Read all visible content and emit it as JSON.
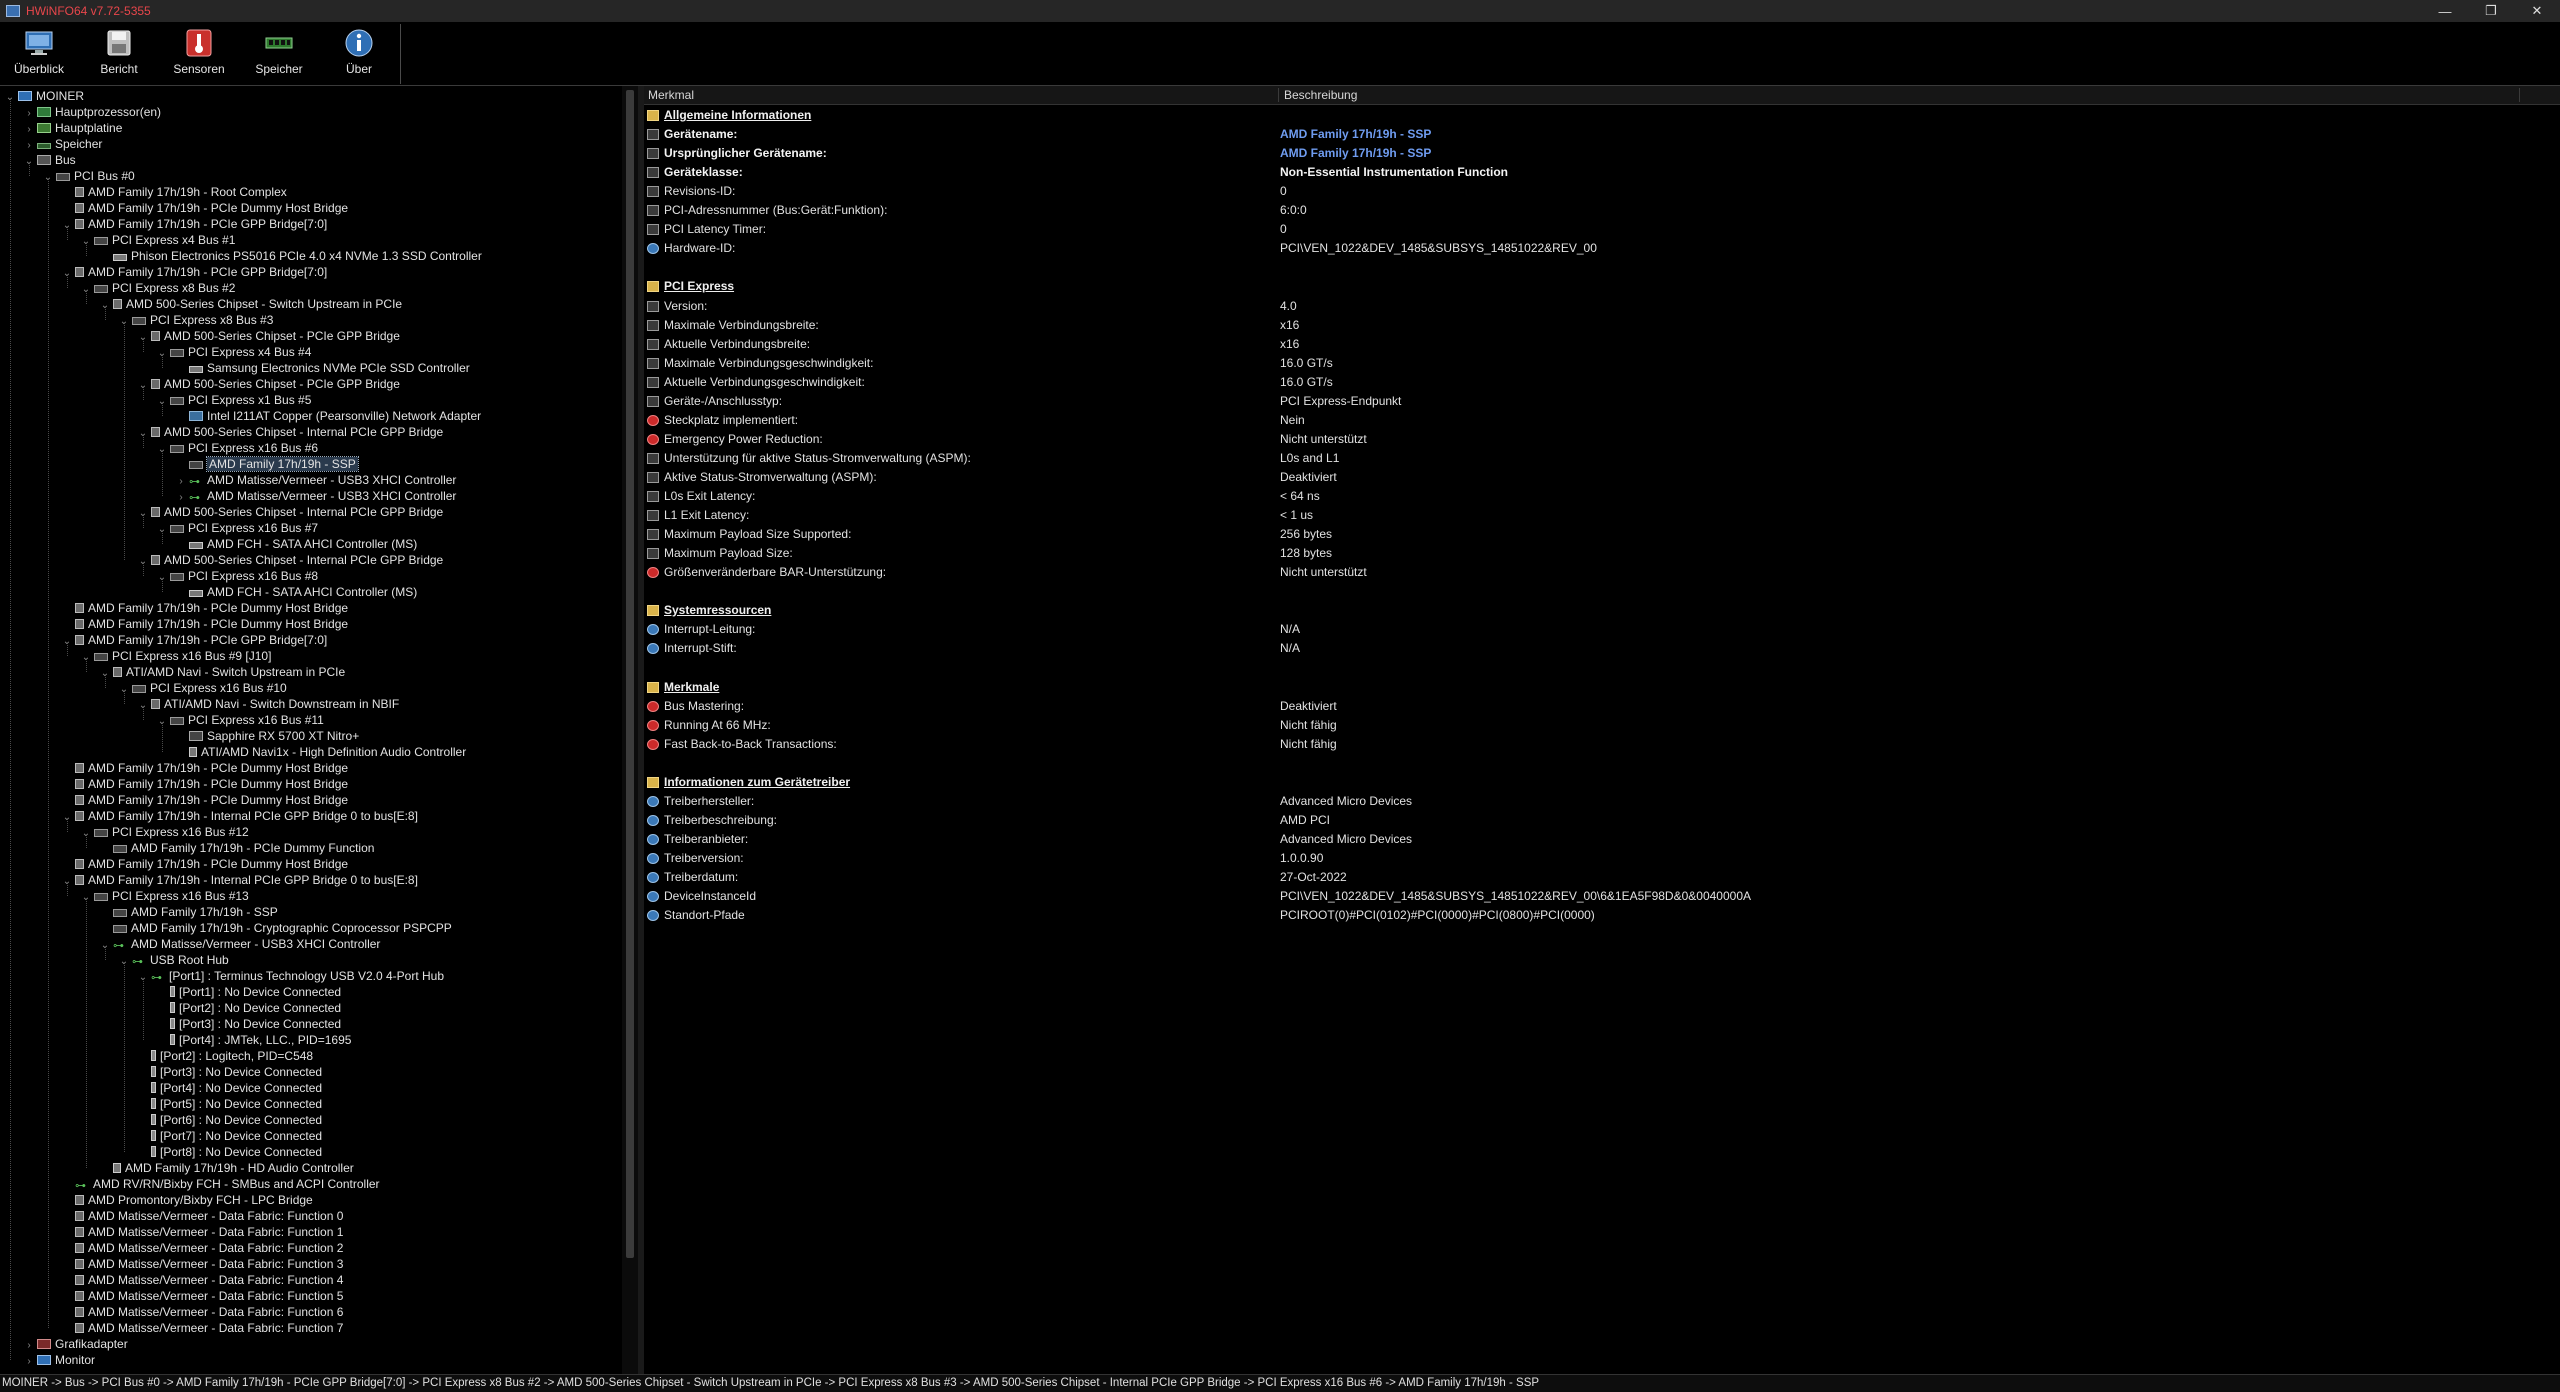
{
  "window": {
    "title": "HWiNFO64 v7.72-5355",
    "controls": {
      "minimize": "—",
      "maximize": "❐",
      "close": "✕"
    }
  },
  "toolbar": {
    "buttons": [
      {
        "label": "Überblick",
        "icon": "overview-icon"
      },
      {
        "label": "Bericht",
        "icon": "save-report-icon"
      },
      {
        "label": "Sensoren",
        "icon": "thermometer-icon"
      },
      {
        "label": "Speicher",
        "icon": "memory-module-icon"
      },
      {
        "label": "Über",
        "icon": "info-icon"
      }
    ]
  },
  "tree": [
    {
      "d": 0,
      "t": "MOINER",
      "i": "pc",
      "x": "open"
    },
    {
      "d": 1,
      "t": "Hauptprozessor(en)",
      "i": "cpu",
      "x": "closed"
    },
    {
      "d": 1,
      "t": "Hauptplatine",
      "i": "board",
      "x": "closed"
    },
    {
      "d": 1,
      "t": "Speicher",
      "i": "mem",
      "x": "closed"
    },
    {
      "d": 1,
      "t": "Bus",
      "i": "bus",
      "x": "open"
    },
    {
      "d": 2,
      "t": "PCI Bus #0",
      "i": "pci",
      "x": "open"
    },
    {
      "d": 3,
      "t": "AMD Family 17h/19h - Root Complex",
      "i": "chip"
    },
    {
      "d": 3,
      "t": "AMD Family 17h/19h - PCIe Dummy Host Bridge",
      "i": "chip"
    },
    {
      "d": 3,
      "t": "AMD Family 17h/19h - PCIe GPP Bridge[7:0]",
      "i": "chip",
      "x": "open"
    },
    {
      "d": 4,
      "t": "PCI Express x4 Bus #1",
      "i": "pci",
      "x": "open"
    },
    {
      "d": 5,
      "t": "Phison Electronics PS5016 PCIe 4.0 x4 NVMe 1.3 SSD Controller",
      "i": "disk"
    },
    {
      "d": 3,
      "t": "AMD Family 17h/19h - PCIe GPP Bridge[7:0]",
      "i": "chip",
      "x": "open"
    },
    {
      "d": 4,
      "t": "PCI Express x8 Bus #2",
      "i": "pci",
      "x": "open"
    },
    {
      "d": 5,
      "t": "AMD 500-Series Chipset - Switch Upstream in PCIe",
      "i": "chip",
      "x": "open"
    },
    {
      "d": 6,
      "t": "PCI Express x8 Bus #3",
      "i": "pci",
      "x": "open"
    },
    {
      "d": 7,
      "t": "AMD 500-Series Chipset - PCIe GPP Bridge",
      "i": "chip",
      "x": "open"
    },
    {
      "d": 8,
      "t": "PCI Express x4 Bus #4",
      "i": "pci",
      "x": "open"
    },
    {
      "d": 9,
      "t": "Samsung Electronics NVMe PCIe SSD Controller",
      "i": "disk"
    },
    {
      "d": 7,
      "t": "AMD 500-Series Chipset - PCIe GPP Bridge",
      "i": "chip",
      "x": "open"
    },
    {
      "d": 8,
      "t": "PCI Express x1 Bus #5",
      "i": "pci",
      "x": "open"
    },
    {
      "d": 9,
      "t": "Intel I211AT Copper (Pearsonville) Network Adapter",
      "i": "net"
    },
    {
      "d": 7,
      "t": "AMD 500-Series Chipset - Internal PCIe GPP Bridge",
      "i": "chip",
      "x": "open"
    },
    {
      "d": 8,
      "t": "PCI Express x16 Bus #6",
      "i": "pci",
      "x": "open"
    },
    {
      "d": 9,
      "t": "AMD Family 17h/19h - SSP",
      "i": "pci",
      "sel": true
    },
    {
      "d": 9,
      "t": "AMD Matisse/Vermeer - USB3 XHCI Controller",
      "i": "usb",
      "x": "closed"
    },
    {
      "d": 9,
      "t": "AMD Matisse/Vermeer - USB3 XHCI Controller",
      "i": "usb",
      "x": "closed"
    },
    {
      "d": 7,
      "t": "AMD 500-Series Chipset - Internal PCIe GPP Bridge",
      "i": "chip",
      "x": "open"
    },
    {
      "d": 8,
      "t": "PCI Express x16 Bus #7",
      "i": "pci",
      "x": "open"
    },
    {
      "d": 9,
      "t": "AMD FCH - SATA AHCI Controller (MS)",
      "i": "disk"
    },
    {
      "d": 7,
      "t": "AMD 500-Series Chipset - Internal PCIe GPP Bridge",
      "i": "chip",
      "x": "open"
    },
    {
      "d": 8,
      "t": "PCI Express x16 Bus #8",
      "i": "pci",
      "x": "open"
    },
    {
      "d": 9,
      "t": "AMD FCH - SATA AHCI Controller (MS)",
      "i": "disk"
    },
    {
      "d": 3,
      "t": "AMD Family 17h/19h - PCIe Dummy Host Bridge",
      "i": "chip"
    },
    {
      "d": 3,
      "t": "AMD Family 17h/19h - PCIe Dummy Host Bridge",
      "i": "chip"
    },
    {
      "d": 3,
      "t": "AMD Family 17h/19h - PCIe GPP Bridge[7:0]",
      "i": "chip",
      "x": "open"
    },
    {
      "d": 4,
      "t": "PCI Express x16 Bus #9 [J10]",
      "i": "pci",
      "x": "open"
    },
    {
      "d": 5,
      "t": "ATI/AMD Navi - Switch Upstream in PCIe",
      "i": "chip",
      "x": "open"
    },
    {
      "d": 6,
      "t": "PCI Express x16 Bus #10",
      "i": "pci",
      "x": "open"
    },
    {
      "d": 7,
      "t": "ATI/AMD Navi - Switch Downstream in NBIF",
      "i": "chip",
      "x": "open"
    },
    {
      "d": 8,
      "t": "PCI Express x16 Bus #11",
      "i": "pci",
      "x": "open"
    },
    {
      "d": 9,
      "t": "Sapphire RX 5700 XT Nitro+",
      "i": "gpu"
    },
    {
      "d": 9,
      "t": "ATI/AMD Navi1x - High Definition Audio Controller",
      "i": "audio"
    },
    {
      "d": 3,
      "t": "AMD Family 17h/19h - PCIe Dummy Host Bridge",
      "i": "chip"
    },
    {
      "d": 3,
      "t": "AMD Family 17h/19h - PCIe Dummy Host Bridge",
      "i": "chip"
    },
    {
      "d": 3,
      "t": "AMD Family 17h/19h - PCIe Dummy Host Bridge",
      "i": "chip"
    },
    {
      "d": 3,
      "t": "AMD Family 17h/19h - Internal PCIe GPP Bridge 0 to bus[E:8]",
      "i": "chip",
      "x": "open"
    },
    {
      "d": 4,
      "t": "PCI Express x16 Bus #12",
      "i": "pci",
      "x": "open"
    },
    {
      "d": 5,
      "t": "AMD Family 17h/19h - PCIe Dummy Function",
      "i": "pci"
    },
    {
      "d": 3,
      "t": "AMD Family 17h/19h - PCIe Dummy Host Bridge",
      "i": "chip"
    },
    {
      "d": 3,
      "t": "AMD Family 17h/19h - Internal PCIe GPP Bridge 0 to bus[E:8]",
      "i": "chip",
      "x": "open"
    },
    {
      "d": 4,
      "t": "PCI Express x16 Bus #13",
      "i": "pci",
      "x": "open"
    },
    {
      "d": 5,
      "t": "AMD Family 17h/19h - SSP",
      "i": "pci"
    },
    {
      "d": 5,
      "t": "AMD Family 17h/19h - Cryptographic Coprocessor PSPCPP",
      "i": "pci"
    },
    {
      "d": 5,
      "t": "AMD Matisse/Vermeer - USB3 XHCI Controller",
      "i": "usb",
      "x": "open"
    },
    {
      "d": 6,
      "t": "USB Root Hub",
      "i": "usb",
      "x": "open"
    },
    {
      "d": 7,
      "t": "[Port1] : Terminus Technology USB V2.0 4-Port Hub",
      "i": "usb",
      "x": "open"
    },
    {
      "d": 8,
      "t": "[Port1] : No Device Connected",
      "i": "plug"
    },
    {
      "d": 8,
      "t": "[Port2] : No Device Connected",
      "i": "plug"
    },
    {
      "d": 8,
      "t": "[Port3] : No Device Connected",
      "i": "plug"
    },
    {
      "d": 8,
      "t": "[Port4] : JMTek, LLC., PID=1695",
      "i": "plug"
    },
    {
      "d": 7,
      "t": "[Port2] : Logitech, PID=C548",
      "i": "plug"
    },
    {
      "d": 7,
      "t": "[Port3] : No Device Connected",
      "i": "plug"
    },
    {
      "d": 7,
      "t": "[Port4] : No Device Connected",
      "i": "plug"
    },
    {
      "d": 7,
      "t": "[Port5] : No Device Connected",
      "i": "plug"
    },
    {
      "d": 7,
      "t": "[Port6] : No Device Connected",
      "i": "plug"
    },
    {
      "d": 7,
      "t": "[Port7] : No Device Connected",
      "i": "plug"
    },
    {
      "d": 7,
      "t": "[Port8] : No Device Connected",
      "i": "plug"
    },
    {
      "d": 5,
      "t": "AMD Family 17h/19h - HD Audio Controller",
      "i": "audio"
    },
    {
      "d": 3,
      "t": "AMD RV/RN/Bixby FCH - SMBus and ACPI Controller",
      "i": "usb"
    },
    {
      "d": 3,
      "t": "AMD Promontory/Bixby FCH - LPC Bridge",
      "i": "chip"
    },
    {
      "d": 3,
      "t": "AMD Matisse/Vermeer - Data Fabric: Function 0",
      "i": "chip"
    },
    {
      "d": 3,
      "t": "AMD Matisse/Vermeer - Data Fabric: Function 1",
      "i": "chip"
    },
    {
      "d": 3,
      "t": "AMD Matisse/Vermeer - Data Fabric: Function 2",
      "i": "chip"
    },
    {
      "d": 3,
      "t": "AMD Matisse/Vermeer - Data Fabric: Function 3",
      "i": "chip"
    },
    {
      "d": 3,
      "t": "AMD Matisse/Vermeer - Data Fabric: Function 4",
      "i": "chip"
    },
    {
      "d": 3,
      "t": "AMD Matisse/Vermeer - Data Fabric: Function 5",
      "i": "chip"
    },
    {
      "d": 3,
      "t": "AMD Matisse/Vermeer - Data Fabric: Function 6",
      "i": "chip"
    },
    {
      "d": 3,
      "t": "AMD Matisse/Vermeer - Data Fabric: Function 7",
      "i": "chip"
    },
    {
      "d": 1,
      "t": "Grafikadapter",
      "i": "disp",
      "x": "closed"
    },
    {
      "d": 1,
      "t": "Monitor",
      "i": "mon",
      "x": "closed"
    }
  ],
  "detail": {
    "headers": {
      "feature": "Merkmal",
      "description": "Beschreibung"
    },
    "rows": [
      {
        "kind": "sec",
        "icon": "folder",
        "label": "Allgemeine Informationen",
        "gap": 0
      },
      {
        "kind": "bold",
        "icon": "pci",
        "label": "Gerätename:",
        "value": "AMD Family 17h/19h - SSP",
        "vstyle": "link"
      },
      {
        "kind": "bold",
        "icon": "pci",
        "label": "Ursprünglicher Gerätename:",
        "value": "AMD Family 17h/19h - SSP",
        "vstyle": "link"
      },
      {
        "kind": "bold",
        "icon": "pci",
        "label": "Geräteklasse:",
        "value": "Non-Essential Instrumentation Function",
        "vstyle": "bold"
      },
      {
        "kind": "row",
        "icon": "pci",
        "label": "Revisions-ID:",
        "value": "0"
      },
      {
        "kind": "row",
        "icon": "pci",
        "label": "PCI-Adressnummer (Bus:Gerät:Funktion):",
        "value": "6:0:0"
      },
      {
        "kind": "row",
        "icon": "pci",
        "label": "PCI Latency Timer:",
        "value": "0"
      },
      {
        "kind": "row",
        "icon": "world",
        "label": "Hardware-ID:",
        "value": "PCI\\VEN_1022&DEV_1485&SUBSYS_14851022&REV_00"
      },
      {
        "kind": "sec",
        "icon": "folder",
        "label": "PCI Express",
        "gap": 1
      },
      {
        "kind": "row",
        "icon": "pci",
        "label": "Version:",
        "value": "4.0"
      },
      {
        "kind": "row",
        "icon": "pci",
        "label": "Maximale Verbindungsbreite:",
        "value": "x16"
      },
      {
        "kind": "row",
        "icon": "pci",
        "label": "Aktuelle Verbindungsbreite:",
        "value": "x16"
      },
      {
        "kind": "row",
        "icon": "pci",
        "label": "Maximale Verbindungsgeschwindigkeit:",
        "value": "16.0 GT/s"
      },
      {
        "kind": "row",
        "icon": "pci",
        "label": "Aktuelle Verbindungsgeschwindigkeit:",
        "value": "16.0 GT/s"
      },
      {
        "kind": "row",
        "icon": "pci",
        "label": "Geräte-/Anschlusstyp:",
        "value": "PCI Express-Endpunkt"
      },
      {
        "kind": "row",
        "icon": "cross",
        "label": "Steckplatz implementiert:",
        "value": "Nein"
      },
      {
        "kind": "row",
        "icon": "cross",
        "label": "Emergency Power Reduction:",
        "value": "Nicht unterstützt"
      },
      {
        "kind": "row",
        "icon": "pci",
        "label": "Unterstützung für aktive Status-Stromverwaltung (ASPM):",
        "value": "L0s and L1"
      },
      {
        "kind": "row",
        "icon": "pci",
        "label": "Aktive Status-Stromverwaltung (ASPM):",
        "value": "Deaktiviert"
      },
      {
        "kind": "row",
        "icon": "pci",
        "label": "L0s Exit Latency:",
        "value": "< 64 ns"
      },
      {
        "kind": "row",
        "icon": "pci",
        "label": "L1 Exit Latency:",
        "value": "< 1 us"
      },
      {
        "kind": "row",
        "icon": "pci",
        "label": "Maximum Payload Size Supported:",
        "value": "256 bytes"
      },
      {
        "kind": "row",
        "icon": "pci",
        "label": "Maximum Payload Size:",
        "value": "128 bytes"
      },
      {
        "kind": "row",
        "icon": "cross",
        "label": "Größenveränderbare BAR-Unterstützung:",
        "value": "Nicht unterstützt"
      },
      {
        "kind": "sec",
        "icon": "folder",
        "label": "Systemressourcen",
        "gap": 1
      },
      {
        "kind": "row",
        "icon": "world",
        "label": "Interrupt-Leitung:",
        "value": "N/A"
      },
      {
        "kind": "row",
        "icon": "world",
        "label": "Interrupt-Stift:",
        "value": "N/A"
      },
      {
        "kind": "sec",
        "icon": "folder",
        "label": "Merkmale",
        "gap": 1
      },
      {
        "kind": "row",
        "icon": "cross",
        "label": "Bus Mastering:",
        "value": "Deaktiviert"
      },
      {
        "kind": "row",
        "icon": "cross",
        "label": "Running At 66 MHz:",
        "value": "Nicht fähig"
      },
      {
        "kind": "row",
        "icon": "cross",
        "label": "Fast Back-to-Back Transactions:",
        "value": "Nicht fähig"
      },
      {
        "kind": "sec",
        "icon": "folder",
        "label": "Informationen zum Gerätetreiber",
        "gap": 1
      },
      {
        "kind": "row",
        "icon": "world",
        "label": "Treiberhersteller:",
        "value": "Advanced Micro Devices"
      },
      {
        "kind": "row",
        "icon": "world",
        "label": "Treiberbeschreibung:",
        "value": "AMD PCI"
      },
      {
        "kind": "row",
        "icon": "world",
        "label": "Treiberanbieter:",
        "value": "Advanced Micro Devices"
      },
      {
        "kind": "row",
        "icon": "world",
        "label": "Treiberversion:",
        "value": "1.0.0.90"
      },
      {
        "kind": "row",
        "icon": "world",
        "label": "Treiberdatum:",
        "value": "27-Oct-2022"
      },
      {
        "kind": "row",
        "icon": "world",
        "label": "DeviceInstanceId",
        "value": "PCI\\VEN_1022&DEV_1485&SUBSYS_14851022&REV_00\\6&1EA5F98D&0&0040000A"
      },
      {
        "kind": "row",
        "icon": "world",
        "label": "Standort-Pfade",
        "value": "PCIROOT(0)#PCI(0102)#PCI(0000)#PCI(0800)#PCI(0000)"
      }
    ]
  },
  "statusbar": {
    "path": "MOINER -> Bus -> PCI Bus #0 -> AMD Family 17h/19h - PCIe GPP Bridge[7:0] -> PCI Express x8 Bus #2 -> AMD 500-Series Chipset - Switch Upstream in PCIe -> PCI Express x8 Bus #3 -> AMD 500-Series Chipset - Internal PCIe GPP Bridge -> PCI Express x16 Bus #6 -> AMD Family 17h/19h - SSP"
  }
}
